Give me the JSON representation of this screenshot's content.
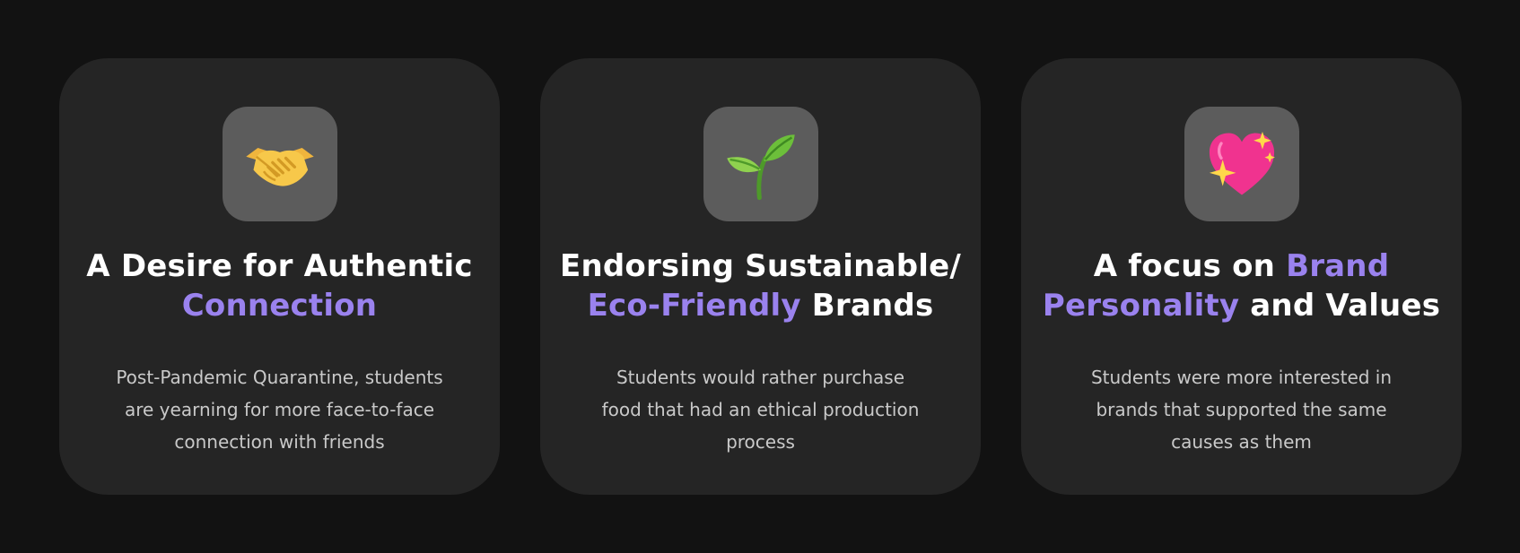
{
  "cards": [
    {
      "icon": "handshake-icon",
      "title": {
        "line1": "A Desire for Authentic",
        "line2_accent": "Connection"
      },
      "description": {
        "line1": "Post-Pandemic Quarantine, students",
        "line2": "are yearning for more face-to-face",
        "line3": "connection with friends"
      }
    },
    {
      "icon": "seedling-icon",
      "title": {
        "line1": "Endorsing Sustainable/",
        "line2_accent": "Eco-Friendly",
        "line2_rest": " Brands"
      },
      "description": {
        "line1": "Students would rather purchase",
        "line2": "food that had an ethical production",
        "line3": "process"
      }
    },
    {
      "icon": "sparkling-heart-icon",
      "title": {
        "line1_plain": "A focus on ",
        "line1_accent": "Brand",
        "line2_accent": "Personality",
        "line2_rest": " and Values"
      },
      "description": {
        "line1": "Students were more interested in",
        "line2": "brands that supported the same",
        "line3": "causes as them"
      }
    }
  ],
  "colors": {
    "background": "#121212",
    "card": "#252525",
    "icon_tile": "#5c5c5c",
    "title": "#ffffff",
    "accent": "#9a82ee",
    "body_text": "#c9c9c9"
  }
}
